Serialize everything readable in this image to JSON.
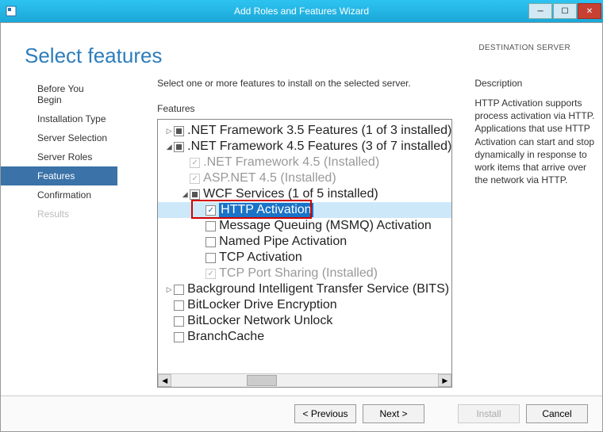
{
  "window": {
    "title": "Add Roles and Features Wizard"
  },
  "page_title": "Select features",
  "destination_label": "DESTINATION SERVER",
  "sidebar": {
    "items": [
      {
        "label": "Before You Begin",
        "state": "normal"
      },
      {
        "label": "Installation Type",
        "state": "normal"
      },
      {
        "label": "Server Selection",
        "state": "normal"
      },
      {
        "label": "Server Roles",
        "state": "normal"
      },
      {
        "label": "Features",
        "state": "active"
      },
      {
        "label": "Confirmation",
        "state": "normal"
      },
      {
        "label": "Results",
        "state": "disabled"
      }
    ]
  },
  "instruction": "Select one or more features to install on the selected server.",
  "section_label": "Features",
  "description": {
    "title": "Description",
    "body": "HTTP Activation supports process activation via HTTP. Applications that use HTTP Activation can start and stop dynamically in response to work items that arrive over the network via HTTP."
  },
  "tree": [
    {
      "indent": 0,
      "exp": "▷",
      "chk": "partial",
      "label": ".NET Framework 3.5 Features (1 of 3 installed)"
    },
    {
      "indent": 0,
      "exp": "◢",
      "chk": "partial",
      "label": ".NET Framework 4.5 Features (3 of 7 installed)"
    },
    {
      "indent": 1,
      "exp": "",
      "chk": "checked",
      "disabled": true,
      "label": ".NET Framework 4.5 (Installed)"
    },
    {
      "indent": 1,
      "exp": "",
      "chk": "checked",
      "disabled": true,
      "label": "ASP.NET 4.5 (Installed)"
    },
    {
      "indent": 1,
      "exp": "◢",
      "chk": "partial",
      "label": "WCF Services (1 of 5 installed)"
    },
    {
      "indent": 2,
      "exp": "",
      "chk": "checked",
      "selected": true,
      "label": "HTTP Activation"
    },
    {
      "indent": 2,
      "exp": "",
      "chk": "",
      "label": "Message Queuing (MSMQ) Activation"
    },
    {
      "indent": 2,
      "exp": "",
      "chk": "",
      "label": "Named Pipe Activation"
    },
    {
      "indent": 2,
      "exp": "",
      "chk": "",
      "label": "TCP Activation"
    },
    {
      "indent": 2,
      "exp": "",
      "chk": "checked",
      "disabled": true,
      "label": "TCP Port Sharing (Installed)"
    },
    {
      "indent": 0,
      "exp": "▷",
      "chk": "",
      "label": "Background Intelligent Transfer Service (BITS)"
    },
    {
      "indent": 0,
      "exp": "",
      "chk": "",
      "label": "BitLocker Drive Encryption"
    },
    {
      "indent": 0,
      "exp": "",
      "chk": "",
      "label": "BitLocker Network Unlock"
    },
    {
      "indent": 0,
      "exp": "",
      "chk": "",
      "label": "BranchCache"
    }
  ],
  "footer": {
    "previous": "< Previous",
    "next": "Next >",
    "install": "Install",
    "cancel": "Cancel"
  }
}
